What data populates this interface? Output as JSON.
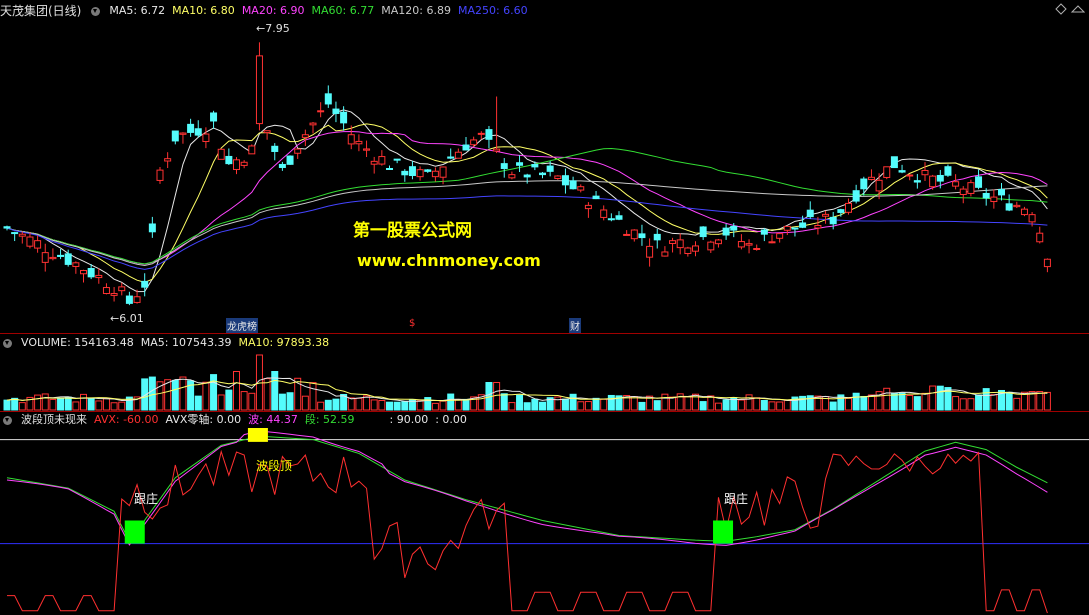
{
  "main_panel": {
    "title": "天茂集团(日线)",
    "ma": [
      {
        "label": "MA5: 6.72",
        "color": "#e8e8e8"
      },
      {
        "label": "MA10: 6.80",
        "color": "#ffff66"
      },
      {
        "label": "MA20: 6.90",
        "color": "#ff44ff"
      },
      {
        "label": "MA60: 6.77",
        "color": "#33dd33"
      },
      {
        "label": "MA120: 6.89",
        "color": "#c8c8c8"
      },
      {
        "label": "MA250: 6.60",
        "color": "#4444ff"
      }
    ],
    "high_label": "7.95",
    "low_label": "6.01",
    "markers": [
      "龙虎榜",
      "$",
      "财"
    ],
    "watermark_line1": "第一股票公式网",
    "watermark_line2": "www.chnmoney.com"
  },
  "volume_panel": {
    "title": "VOLUME: 154163.48",
    "ma": [
      {
        "label": "MA5: 107543.39",
        "color": "#e8e8e8"
      },
      {
        "label": "MA10: 97893.38",
        "color": "#ffff66"
      }
    ]
  },
  "indicator_panel": {
    "title": "波段顶未现来",
    "items": [
      {
        "label": "AVX: -60.00",
        "color": "#ff3030"
      },
      {
        "label": "AVX零轴: 0.00",
        "color": "#e8e8e8"
      },
      {
        "label": "波: 44.37",
        "color": "#ff44ff"
      },
      {
        "label": "段: 52.59",
        "color": "#33dd33"
      },
      {
        "label": ": 90.00",
        "color": "#e8e8e8"
      },
      {
        "label": ": 0.00",
        "color": "#e8e8e8"
      }
    ],
    "annotations": [
      "跟庄",
      "波段顶",
      "跟庄"
    ]
  },
  "colors": {
    "up": "#ff3232",
    "down": "#54fcfc",
    "background": "#000000"
  },
  "chart_data": [
    {
      "type": "candlestick",
      "title": "天茂集团(日线)",
      "ylim": [
        5.9,
        8.1
      ],
      "high": 7.95,
      "low": 6.01,
      "series": [
        {
          "name": "MA5",
          "last": 6.72
        },
        {
          "name": "MA10",
          "last": 6.8
        },
        {
          "name": "MA20",
          "last": 6.9
        },
        {
          "name": "MA60",
          "last": 6.77
        },
        {
          "name": "MA120",
          "last": 6.89
        },
        {
          "name": "MA250",
          "last": 6.6
        }
      ]
    },
    {
      "type": "bar",
      "title": "VOLUME",
      "series": [
        {
          "name": "VOLUME",
          "last": 154163.48
        },
        {
          "name": "MA5",
          "last": 107543.39
        },
        {
          "name": "MA10",
          "last": 97893.38
        }
      ]
    },
    {
      "type": "line",
      "title": "波段顶未现来",
      "ylim": [
        -60,
        100
      ],
      "series": [
        {
          "name": "AVX",
          "last": -60.0
        },
        {
          "name": "AVX零轴",
          "last": 0.0
        },
        {
          "name": "波",
          "last": 44.37
        },
        {
          "name": "段",
          "last": 52.59
        }
      ],
      "levels": [
        90,
        0
      ]
    }
  ]
}
